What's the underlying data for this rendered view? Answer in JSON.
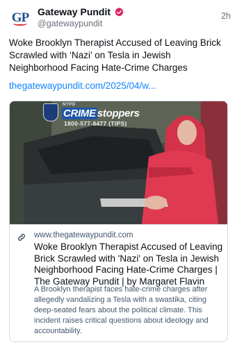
{
  "post": {
    "avatar_text": "GP",
    "display_name": "Gateway Pundit",
    "handle": "@gatewaypundit",
    "time": "2h",
    "text": "Woke Brooklyn Therapist Accused of Leaving Brick Scrawled with ‘Nazi’ on Tesla in Jewish Neighborhood Facing Hate-Crime Charges",
    "link": "thegatewaypundit.com/2025/04/w..."
  },
  "card": {
    "domain": "www.thegatewaypundit.com",
    "title": "Woke Brooklyn Therapist Accused of Leaving Brick Scrawled with 'Nazi' on Tesla in Jewish Neighborhood Facing Hate-Crime Charges | The Gateway Pundit | by Margaret Flavin",
    "description": "A Brooklyn therapist faces hate-crime charges after allegedly vandalizing a Tesla with a swastika, citing deep-seated fears about the political climate. This incident raises critical questions about ideology and accountability.",
    "image": {
      "nypd_label": "NYPD",
      "crime_word": "CRIME",
      "stoppers_word": "stoppers",
      "phone": "1800-577-8477 (TIPS)"
    }
  },
  "colors": {
    "link_blue": "#1083fe",
    "verified_red": "#e0245e",
    "muted": "#68717d",
    "border": "#d4dbe2"
  },
  "icons": {
    "verified": "verified-badge-icon",
    "link": "link-chain-icon"
  }
}
